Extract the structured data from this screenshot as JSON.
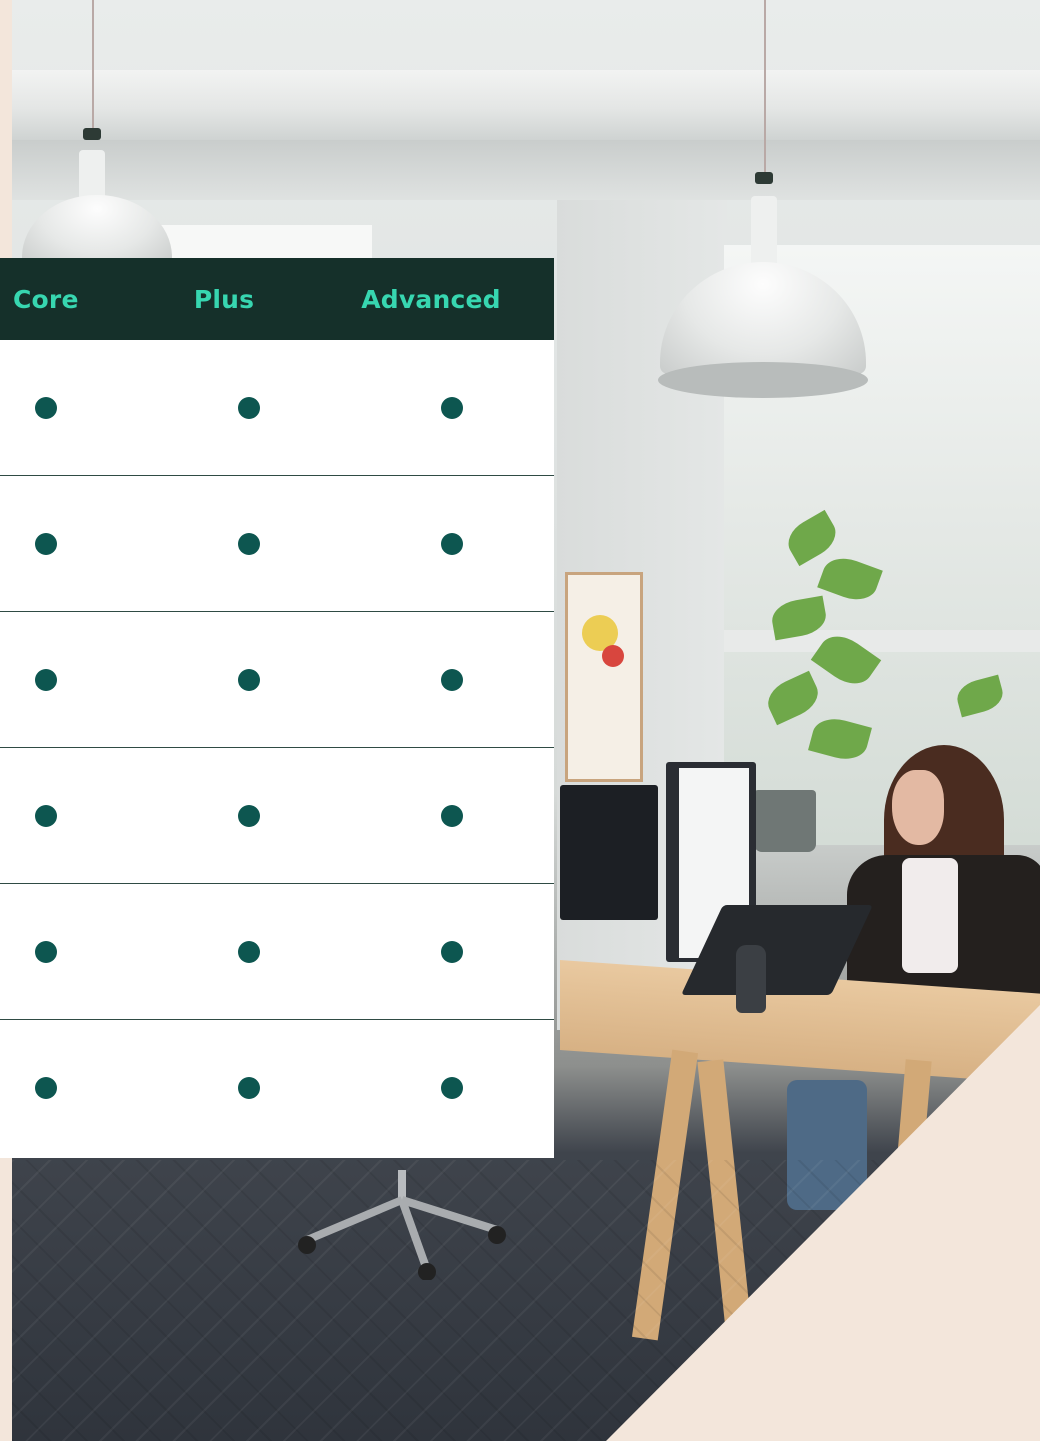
{
  "plans": {
    "columns": [
      "Core",
      "Plus",
      "Advanced"
    ],
    "rows": [
      {
        "core": true,
        "plus": true,
        "advanced": true
      },
      {
        "core": true,
        "plus": true,
        "advanced": true
      },
      {
        "core": true,
        "plus": true,
        "advanced": true
      },
      {
        "core": true,
        "plus": true,
        "advanced": true
      },
      {
        "core": true,
        "plus": true,
        "advanced": true
      },
      {
        "core": true,
        "plus": true,
        "advanced": true
      }
    ]
  },
  "colors": {
    "header_bg": "#15302a",
    "header_text": "#37d6b0",
    "dot": "#0d5650",
    "row_divider": "#2f4b44",
    "accent_beige": "#f3e6db"
  },
  "icons": {
    "included": "filled-circle-icon"
  }
}
